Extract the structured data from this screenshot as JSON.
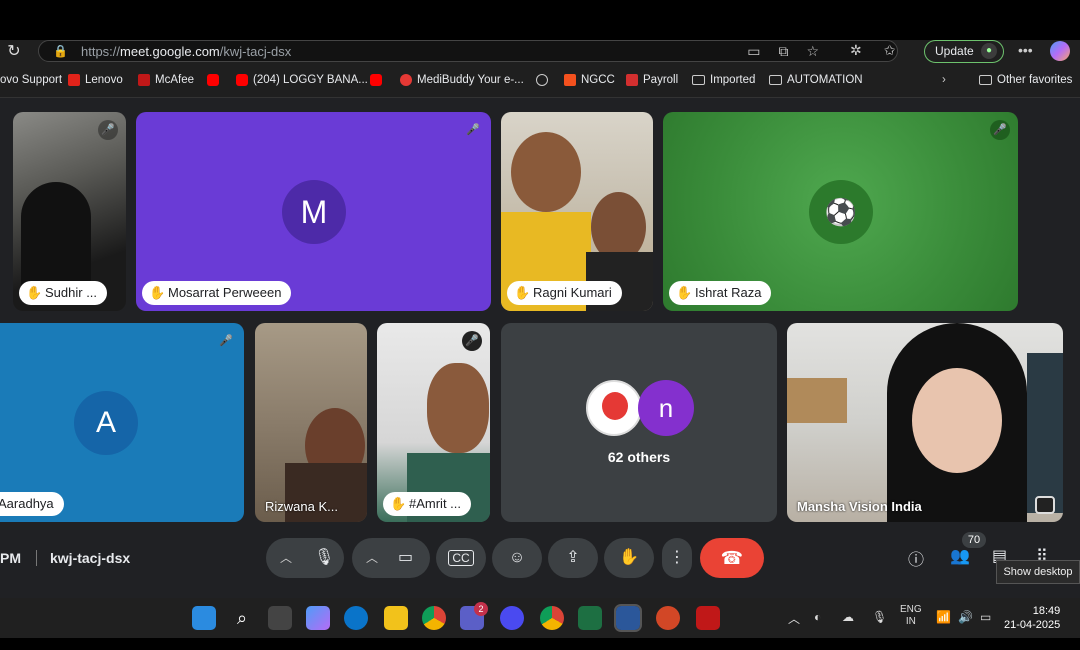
{
  "browser": {
    "url_prefix": "https://",
    "url_host": "meet.google.com",
    "url_path": "/kwj-tacj-dsx",
    "update_label": "Update"
  },
  "bookmarks": [
    {
      "label": "ovo Support"
    },
    {
      "label": "Lenovo"
    },
    {
      "label": "McAfee"
    },
    {
      "label": ""
    },
    {
      "label": "(204) LOGGY BANA..."
    },
    {
      "label": ""
    },
    {
      "label": "MediBuddy Your e-..."
    },
    {
      "label": ""
    },
    {
      "label": "NGCC"
    },
    {
      "label": "Payroll"
    },
    {
      "label": "Imported"
    },
    {
      "label": "AUTOMATION"
    },
    {
      "label": "Other favorites"
    }
  ],
  "tiles": {
    "sudhir": {
      "name": "Sudhir ..."
    },
    "mosarrat": {
      "name": "Mosarrat Perweeen",
      "initial": "M"
    },
    "ragni": {
      "name": "Ragni Kumari"
    },
    "ishrat": {
      "name": "Ishrat Raza"
    },
    "aaradhya": {
      "name": "Aaradhya",
      "initial": "A"
    },
    "rizwana": {
      "name": "Rizwana K..."
    },
    "amrit": {
      "name": "#Amrit ..."
    },
    "others": {
      "label": "62 others",
      "initial": "n"
    },
    "mansha": {
      "name": "Mansha Vision India"
    }
  },
  "meeting": {
    "time": "PM",
    "code": "kwj-tacj-dsx",
    "participant_count": "70",
    "tooltip": "Show desktop"
  },
  "taskbar": {
    "teams_badge": "2",
    "lang1": "ENG",
    "lang2": "IN",
    "time": "18:49",
    "date": "21-04-2025"
  },
  "colors": {
    "meet_bg": "#202124",
    "purple_tile": "#6a3bd6",
    "green_tile": "#3f9a3f",
    "blue_tile": "#1a7bb8",
    "end_call": "#ea4335"
  }
}
